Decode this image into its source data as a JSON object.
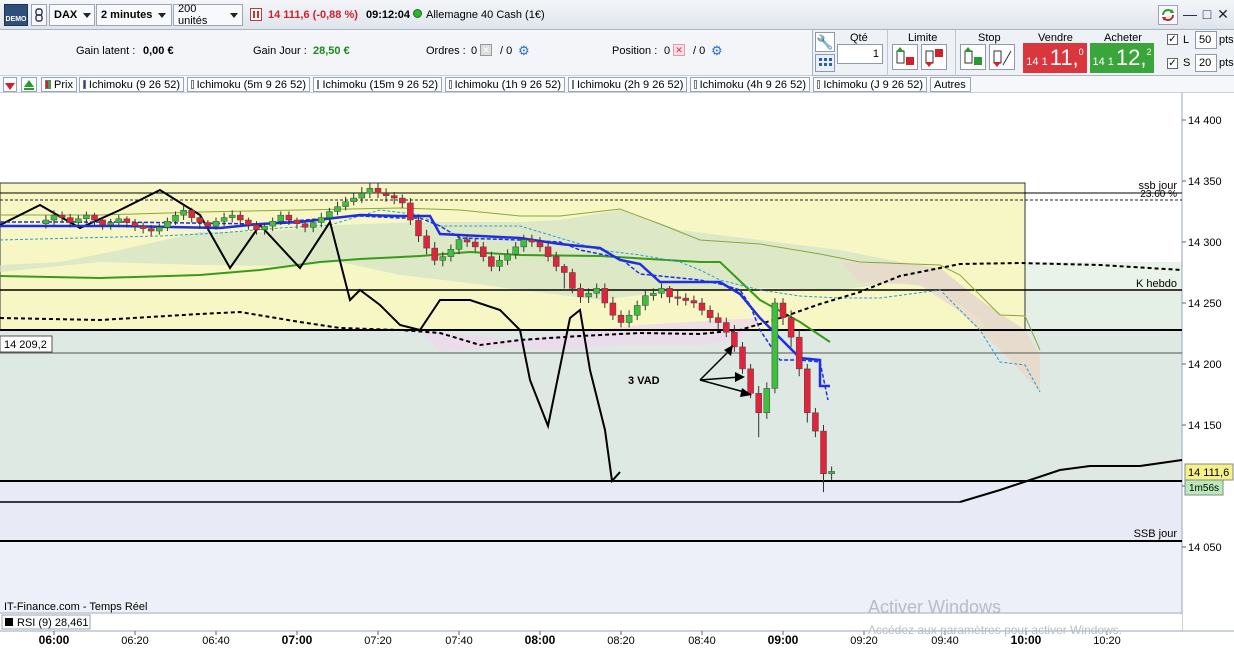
{
  "topbar": {
    "demo_badge": "DEMO",
    "instrument": "DAX",
    "timeframe": "2 minutes",
    "units": "200 unités",
    "price_change": "14 111,6 (-0,88 %)",
    "time": "09:12:04",
    "market": "Allemagne 40 Cash (1€)"
  },
  "info": {
    "gain_latent_label": "Gain latent :",
    "gain_latent_value": "0,00 €",
    "gain_jour_label": "Gain Jour :",
    "gain_jour_value": "28,50 €",
    "ordres_label": "Ordres :",
    "ordres_value_a": "0",
    "ordres_value_b": "/ 0",
    "position_label": "Position :",
    "position_value_a": "0",
    "position_value_b": "/ 0"
  },
  "order_panel": {
    "qty_label": "Qté",
    "qty_value": "1",
    "limit_label": "Limite",
    "stop_label": "Stop",
    "sell_label": "Vendre",
    "buy_label": "Acheter",
    "sell_price_prefix": "14 1",
    "sell_price_main": "11,",
    "sell_price_sup": "0",
    "buy_price_prefix": "14 1",
    "buy_price_main": "12,",
    "buy_price_sup": "2",
    "l_label": "L",
    "l_value": "50",
    "s_label": "S",
    "s_value": "20",
    "pts": "pts"
  },
  "legend": {
    "prix": "Prix",
    "items": [
      "Ichimoku (9 26 52)",
      "Ichimoku (5m 9 26 52)",
      "Ichimoku (15m 9 26 52)",
      "Ichimoku (1h 9 26 52)",
      "Ichimoku (2h 9 26 52)",
      "Ichimoku (4h 9 26 52)",
      "Ichimoku (J 9 26 52)"
    ],
    "autres": "Autres"
  },
  "chart": {
    "y_ticks": [
      "14 400",
      "14 350",
      "14 300",
      "14 250",
      "14 200",
      "14 150",
      "14 100",
      "14 050"
    ],
    "level_labels": {
      "ssb_jour_top": "ssb jour",
      "fib": "23.60 %",
      "k_hebdo": "K hebdo",
      "ssb_jour_bottom": "SSB jour"
    },
    "left_price_label": "14 209,2",
    "current_price_label": "14 111,6",
    "countdown": "1m56s",
    "annotation": "3 VAD",
    "source": "IT-Finance.com - Temps Réel",
    "rsi_label": "RSI (9) 28,461",
    "x_ticks": [
      "06:00",
      "06:20",
      "06:40",
      "07:00",
      "07:20",
      "07:40",
      "08:00",
      "08:20",
      "08:40",
      "09:00",
      "09:20",
      "09:40",
      "10:00",
      "10:20"
    ],
    "watermark_title": "Activer Windows",
    "watermark_sub": "Accédez aux paramètres pour activer Windows."
  },
  "colors": {
    "up_candle": "#3fbf3f",
    "down_candle": "#e0243c",
    "tenkan": "#1f2fe0",
    "kijun_green": "#3a9a1a",
    "cloud_yellow": "#f6f6c4",
    "sell_bg": "#d9363e",
    "buy_bg": "#3aa53a"
  },
  "chart_data": {
    "type": "candlestick",
    "x": [
      "05:58",
      "06:00",
      "06:02",
      "06:04",
      "06:06",
      "06:08",
      "06:10",
      "06:12",
      "06:14",
      "06:16",
      "06:18",
      "06:20",
      "06:22",
      "06:24",
      "06:26",
      "06:28",
      "06:30",
      "06:32",
      "06:34",
      "06:36",
      "06:38",
      "06:40",
      "06:42",
      "06:44",
      "06:46",
      "06:48",
      "06:50",
      "06:52",
      "06:54",
      "06:56",
      "06:58",
      "07:00",
      "07:02",
      "07:04",
      "07:06",
      "07:08",
      "07:10",
      "07:12",
      "07:14",
      "07:16",
      "07:18",
      "07:20",
      "07:22",
      "07:24",
      "07:26",
      "07:28",
      "07:30",
      "07:32",
      "07:34",
      "07:36",
      "07:38",
      "07:40",
      "07:42",
      "07:44",
      "07:46",
      "07:48",
      "07:50",
      "07:52",
      "07:54",
      "07:56",
      "07:58",
      "08:00",
      "08:02",
      "08:04",
      "08:06",
      "08:08",
      "08:10",
      "08:12",
      "08:14",
      "08:16",
      "08:18",
      "08:20",
      "08:22",
      "08:24",
      "08:26",
      "08:28",
      "08:30",
      "08:32",
      "08:34",
      "08:36",
      "08:38",
      "08:40",
      "08:42",
      "08:44",
      "08:46",
      "08:48",
      "08:50",
      "08:52",
      "08:54",
      "08:56",
      "08:58",
      "09:00",
      "09:02",
      "09:04",
      "09:06",
      "09:08",
      "09:10",
      "09:12"
    ],
    "open": [
      14315,
      14318,
      14322,
      14320,
      14316,
      14319,
      14322,
      14318,
      14314,
      14316,
      14319,
      14316,
      14313,
      14311,
      14309,
      14312,
      14317,
      14322,
      14326,
      14320,
      14316,
      14313,
      14317,
      14320,
      14322,
      14318,
      14314,
      14310,
      14313,
      14317,
      14322,
      14318,
      14315,
      14312,
      14316,
      14320,
      14325,
      14329,
      14333,
      14336,
      14340,
      14344,
      14340,
      14338,
      14336,
      14332,
      14318,
      14305,
      14295,
      14285,
      14288,
      14294,
      14302,
      14300,
      14296,
      14288,
      14280,
      14285,
      14290,
      14296,
      14302,
      14300,
      14296,
      14288,
      14280,
      14275,
      14262,
      14255,
      14258,
      14262,
      14250,
      14240,
      14234,
      14240,
      14248,
      14256,
      14258,
      14262,
      14255,
      14254,
      14252,
      14250,
      14244,
      14238,
      14234,
      14226,
      14214,
      14196,
      14176,
      14160,
      14180,
      14250,
      14238,
      14222,
      14196,
      14160,
      14145,
      14110
    ],
    "close": [
      14318,
      14322,
      14320,
      14316,
      14319,
      14322,
      14318,
      14314,
      14316,
      14319,
      14316,
      14313,
      14311,
      14309,
      14312,
      14317,
      14322,
      14326,
      14320,
      14316,
      14313,
      14317,
      14320,
      14322,
      14318,
      14314,
      14310,
      14313,
      14317,
      14322,
      14318,
      14315,
      14312,
      14316,
      14320,
      14325,
      14329,
      14333,
      14336,
      14340,
      14344,
      14340,
      14338,
      14336,
      14332,
      14318,
      14305,
      14295,
      14285,
      14288,
      14294,
      14302,
      14300,
      14296,
      14288,
      14280,
      14285,
      14290,
      14296,
      14302,
      14300,
      14296,
      14288,
      14280,
      14275,
      14262,
      14255,
      14258,
      14262,
      14250,
      14240,
      14234,
      14240,
      14248,
      14256,
      14258,
      14262,
      14255,
      14254,
      14252,
      14250,
      14244,
      14238,
      14234,
      14226,
      14214,
      14196,
      14176,
      14160,
      14180,
      14250,
      14238,
      14222,
      14196,
      14160,
      14145,
      14110,
      14112
    ],
    "high": [
      14322,
      14326,
      14325,
      14323,
      14322,
      14325,
      14324,
      14320,
      14319,
      14322,
      14321,
      14319,
      14316,
      14314,
      14315,
      14320,
      14325,
      14330,
      14328,
      14322,
      14318,
      14320,
      14324,
      14326,
      14325,
      14320,
      14317,
      14316,
      14320,
      14325,
      14325,
      14320,
      14318,
      14319,
      14324,
      14328,
      14333,
      14337,
      14340,
      14345,
      14348,
      14348,
      14344,
      14341,
      14339,
      14336,
      14322,
      14310,
      14300,
      14292,
      14298,
      14306,
      14306,
      14303,
      14300,
      14292,
      14289,
      14294,
      14300,
      14306,
      14306,
      14304,
      14300,
      14292,
      14282,
      14278,
      14266,
      14262,
      14266,
      14266,
      14255,
      14244,
      14244,
      14252,
      14260,
      14262,
      14266,
      14264,
      14260,
      14258,
      14256,
      14254,
      14248,
      14242,
      14238,
      14232,
      14218,
      14200,
      14182,
      14185,
      14254,
      14254,
      14244,
      14228,
      14200,
      14164,
      14150,
      14116
    ],
    "low": [
      14311,
      14314,
      14316,
      14312,
      14312,
      14315,
      14314,
      14310,
      14310,
      14312,
      14312,
      14309,
      14307,
      14305,
      14306,
      14309,
      14314,
      14318,
      14316,
      14311,
      14309,
      14310,
      14313,
      14316,
      14314,
      14310,
      14306,
      14306,
      14309,
      14314,
      14314,
      14311,
      14308,
      14308,
      14312,
      14317,
      14322,
      14326,
      14330,
      14332,
      14336,
      14336,
      14333,
      14331,
      14328,
      14314,
      14300,
      14290,
      14281,
      14280,
      14284,
      14290,
      14296,
      14292,
      14284,
      14276,
      14276,
      14281,
      14286,
      14292,
      14296,
      14292,
      14284,
      14276,
      14262,
      14258,
      14250,
      14250,
      14254,
      14246,
      14236,
      14230,
      14230,
      14236,
      14244,
      14252,
      14254,
      14250,
      14248,
      14248,
      14246,
      14240,
      14234,
      14228,
      14222,
      14210,
      14192,
      14172,
      14140,
      14155,
      14176,
      14232,
      14214,
      14190,
      14152,
      14140,
      14095,
      14105
    ],
    "ylim": [
      14040,
      14420
    ]
  }
}
